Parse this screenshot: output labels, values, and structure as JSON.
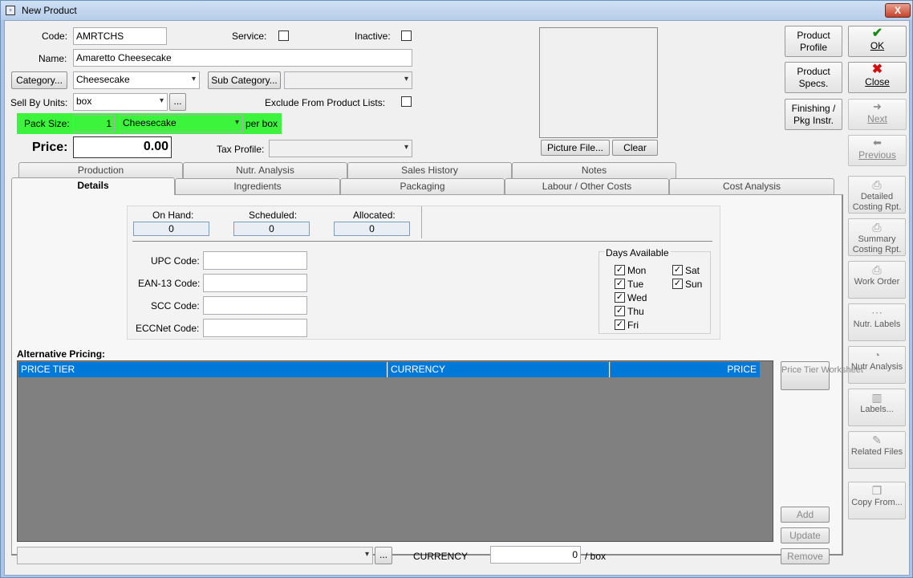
{
  "window": {
    "title": "New Product",
    "close_glyph": "X"
  },
  "form": {
    "code_label": "Code:",
    "code_value": "AMRTCHS",
    "service_label": "Service:",
    "inactive_label": "Inactive:",
    "name_label": "Name:",
    "name_value": "Amaretto Cheesecake",
    "category_button": "Category...",
    "category_value": "Cheesecake",
    "subcategory_button": "Sub Category...",
    "subcategory_value": "",
    "sellby_label": "Sell By Units:",
    "sellby_value": "box",
    "ellipsis": "...",
    "exclude_label": "Exclude From Product Lists:",
    "packsize_label": "Pack Size:",
    "packsize_value": "1",
    "pack_item_value": "Cheesecake",
    "per_unit": "per box",
    "price_label": "Price:",
    "price_value": "0.00",
    "tax_label": "Tax Profile:",
    "tax_value": "",
    "highlight_color": "#3df43d"
  },
  "picture": {
    "file_button": "Picture File...",
    "clear_button": "Clear"
  },
  "right_buttons": {
    "product_profile": "Product Profile",
    "product_specs": "Product Specs.",
    "finishing": "Finishing / Pkg Instr.",
    "ok": "OK",
    "close": "Close",
    "next": "Next",
    "previous": "Previous"
  },
  "tabs_top": [
    "Production",
    "Nutr. Analysis",
    "Sales History",
    "Notes"
  ],
  "tabs_bottom": [
    "Details",
    "Ingredients",
    "Packaging",
    "Labour / Other Costs",
    "Cost Analysis"
  ],
  "details": {
    "on_hand_label": "On Hand:",
    "on_hand_value": "0",
    "scheduled_label": "Scheduled:",
    "scheduled_value": "0",
    "allocated_label": "Allocated:",
    "allocated_value": "0",
    "upc_label": "UPC Code:",
    "ean_label": "EAN-13 Code:",
    "scc_label": "SCC Code:",
    "eccnet_label": "ECCNet Code:",
    "days_title": "Days Available",
    "days": [
      "Mon",
      "Tue",
      "Wed",
      "Thu",
      "Fri",
      "Sat",
      "Sun"
    ]
  },
  "pricing": {
    "title": "Alternative Pricing:",
    "columns": [
      "PRICE TIER",
      "CURRENCY",
      "PRICE"
    ],
    "worksheet_button": "Price Tier Worksheet",
    "add_button": "Add",
    "update_button": "Update",
    "remove_button": "Remove",
    "currency_label": "CURRENCY",
    "amount_value": "0",
    "per_box": "/ box",
    "header_color": "#0078d7"
  },
  "side_buttons": {
    "detailed_costing": "Detailed Costing Rpt.",
    "summary_costing": "Summary Costing Rpt.",
    "work_order": "Work Order",
    "nutr_labels": "Nutr. Labels",
    "nutr_analysis": "Nutr Analysis",
    "labels": "Labels...",
    "related_files": "Related Files",
    "copy_from": "Copy From..."
  }
}
